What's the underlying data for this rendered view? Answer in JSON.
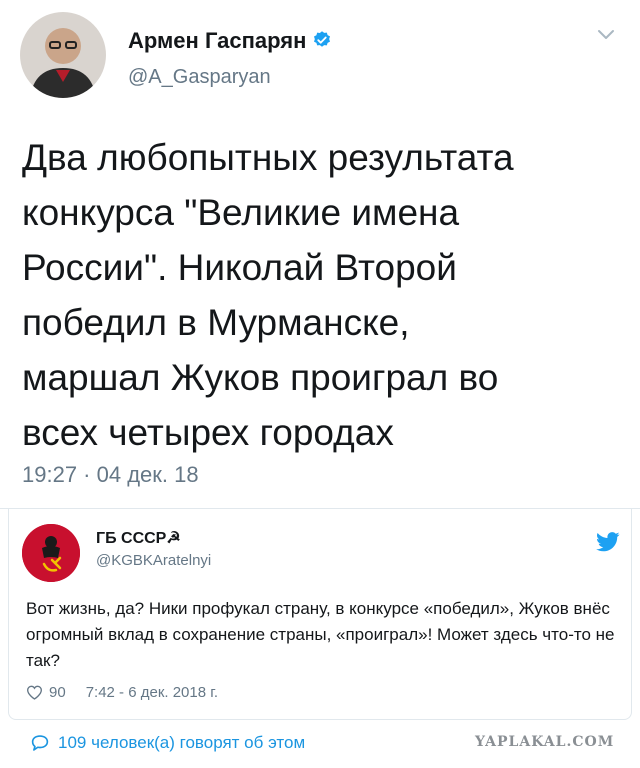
{
  "tweet": {
    "author_name": "Армен Гаспарян",
    "author_handle": "@A_Gasparyan",
    "text": "Два любопытных результата\nконкурса \"Великие имена\nРоссии\". Николай Второй\nпобедил в Мурманске,\nмаршал Жуков проиграл во\nвсех четырех городах",
    "time": "19:27 · 04 дек. 18"
  },
  "reply": {
    "author_name": "ГБ СССР☭",
    "author_handle": "@KGBKAratelnyi",
    "text": "Вот жизнь, да? Ники профукал  страну, в конкурсе «победил», Жуков внёс огромный вклад в сохранение страны, «проиграл»!  Может здесь что-то не так?",
    "likes": "90",
    "time": "7:42 - 6 дек. 2018 г."
  },
  "footer": {
    "talk_label": "109 человек(а) говорят об этом"
  },
  "watermark": "YAPLAKAL.COM",
  "colors": {
    "link": "#1b95e0",
    "verified": "#1da1f2",
    "muted": "#657786",
    "soviet_red": "#c8102e"
  },
  "icons": {
    "verified": "verified-badge-icon",
    "chevron": "chevron-down-icon",
    "twitter": "twitter-bird-icon",
    "like": "heart-icon",
    "reply": "comment-bubble-icon"
  }
}
